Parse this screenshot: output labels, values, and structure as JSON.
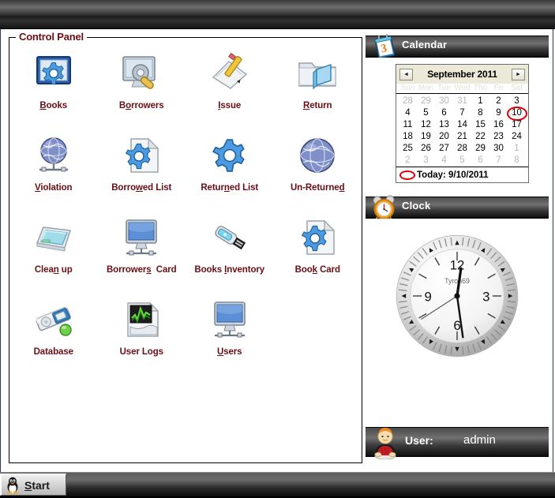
{
  "window": {
    "titlebar_text": ""
  },
  "control_panel": {
    "title": "Control Panel",
    "items": [
      {
        "label": "Books",
        "accel": "B",
        "icon": "gear-monitor-icon"
      },
      {
        "label": "Borrowers",
        "accel": "o",
        "icon": "monitor-wrench-icon"
      },
      {
        "label": "Issue",
        "accel": "I",
        "icon": "pencil-paper-icon"
      },
      {
        "label": "Return",
        "accel": "R",
        "icon": "folder-book-icon"
      },
      {
        "label": "Violation",
        "accel": "V",
        "icon": "globe-network-icon"
      },
      {
        "label": "Borrowed List",
        "accel": "w",
        "icon": "gear-document-icon"
      },
      {
        "label": "Returned List",
        "accel": "n",
        "icon": "gear-icon"
      },
      {
        "label": "Un-Returned",
        "accel": "d",
        "icon": "globe-icon"
      },
      {
        "label": "Clean up",
        "accel": "n",
        "icon": "tablet-icon"
      },
      {
        "label": "Borrowers  Card",
        "accel": "s",
        "icon": "monitor-network-icon"
      },
      {
        "label": "Books Inventory",
        "accel": "I",
        "icon": "usb-drive-icon"
      },
      {
        "label": "Book Card",
        "accel": "k",
        "icon": "gear-document-icon"
      },
      {
        "label": "Database",
        "accel": "",
        "icon": "database-disk-icon"
      },
      {
        "label": "User Logs",
        "accel": "g",
        "icon": "chart-document-icon"
      },
      {
        "label": "Users",
        "accel": "U",
        "icon": "monitor-network-icon"
      }
    ]
  },
  "calendar": {
    "panel_title": "Calendar",
    "panel_icon": "calendar-icon",
    "prev_label": "◄",
    "next_label": "►",
    "month_title": "September 2011",
    "day_names": [
      "Sun",
      "Mon",
      "Tue",
      "Wed",
      "Tho",
      "Fri",
      "Sat"
    ],
    "weeks": [
      [
        {
          "d": "28",
          "dim": true
        },
        {
          "d": "29",
          "dim": true
        },
        {
          "d": "30",
          "dim": true
        },
        {
          "d": "31",
          "dim": true
        },
        {
          "d": "1",
          "dim": false
        },
        {
          "d": "2",
          "dim": false
        },
        {
          "d": "3",
          "dim": false
        }
      ],
      [
        {
          "d": "4",
          "dim": false
        },
        {
          "d": "5",
          "dim": false
        },
        {
          "d": "6",
          "dim": false
        },
        {
          "d": "7",
          "dim": false
        },
        {
          "d": "8",
          "dim": false
        },
        {
          "d": "9",
          "dim": false
        },
        {
          "d": "10",
          "dim": false,
          "today": true
        }
      ],
      [
        {
          "d": "11",
          "dim": false
        },
        {
          "d": "12",
          "dim": false
        },
        {
          "d": "13",
          "dim": false
        },
        {
          "d": "14",
          "dim": false
        },
        {
          "d": "15",
          "dim": false
        },
        {
          "d": "16",
          "dim": false
        },
        {
          "d": "17",
          "dim": false
        }
      ],
      [
        {
          "d": "18",
          "dim": false
        },
        {
          "d": "19",
          "dim": false
        },
        {
          "d": "20",
          "dim": false
        },
        {
          "d": "21",
          "dim": false
        },
        {
          "d": "22",
          "dim": false
        },
        {
          "d": "23",
          "dim": false
        },
        {
          "d": "24",
          "dim": false
        }
      ],
      [
        {
          "d": "25",
          "dim": false
        },
        {
          "d": "26",
          "dim": false
        },
        {
          "d": "27",
          "dim": false
        },
        {
          "d": "28",
          "dim": false
        },
        {
          "d": "29",
          "dim": false
        },
        {
          "d": "30",
          "dim": false
        },
        {
          "d": "1",
          "dim": true
        }
      ],
      [
        {
          "d": "2",
          "dim": true
        },
        {
          "d": "3",
          "dim": true
        },
        {
          "d": "4",
          "dim": true
        },
        {
          "d": "5",
          "dim": true
        },
        {
          "d": "6",
          "dim": true
        },
        {
          "d": "7",
          "dim": true
        },
        {
          "d": "8",
          "dim": true
        }
      ]
    ],
    "today_text": "Today: 9/10/2011"
  },
  "clock": {
    "panel_title": "Clock",
    "panel_icon": "alarm-clock-icon",
    "brand": "Tyron69",
    "numerals": [
      "12",
      "3",
      "6",
      "9"
    ],
    "hour_angle_deg": 8,
    "minute_angle_deg": 172,
    "second_angle_deg": 237
  },
  "user": {
    "label": "User:",
    "name": "admin",
    "avatar_icon": "user-avatar-icon"
  },
  "taskbar": {
    "start_label": "Start",
    "start_accel": "S",
    "start_icon": "tux-linux-icon"
  },
  "colors": {
    "label_maroon": "#6b0d14",
    "today_red": "#e00000",
    "panel_bar_dark": "#0e0e0e",
    "window_bg": "#ffffff"
  }
}
